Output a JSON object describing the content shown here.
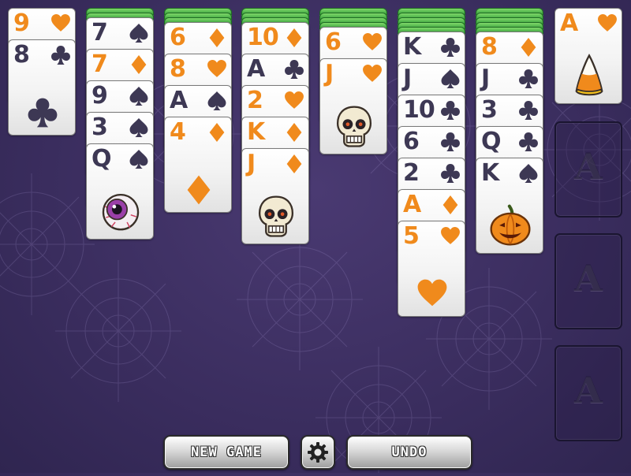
{
  "colors": {
    "background": "#3a2d5e",
    "card_back": "#2e9a36",
    "red_suit": "#f08a1c",
    "black_suit": "#3d3854"
  },
  "buttons": {
    "new_game": "NEW GAME",
    "settings_icon": "gear-icon",
    "undo": "UNDO"
  },
  "stock": {
    "cards": [
      {
        "rank": "9",
        "suit": "hearts"
      },
      {
        "rank": "8",
        "suit": "clubs"
      }
    ]
  },
  "tableau": [
    {
      "face_down": 2,
      "cards": [
        {
          "rank": "7",
          "suit": "spades"
        },
        {
          "rank": "7",
          "suit": "diamonds"
        },
        {
          "rank": "9",
          "suit": "spades"
        },
        {
          "rank": "3",
          "suit": "spades"
        },
        {
          "rank": "Q",
          "suit": "spades",
          "art": "eyeball"
        }
      ]
    },
    {
      "face_down": 3,
      "cards": [
        {
          "rank": "6",
          "suit": "diamonds"
        },
        {
          "rank": "8",
          "suit": "hearts"
        },
        {
          "rank": "A",
          "suit": "spades"
        },
        {
          "rank": "4",
          "suit": "diamonds"
        }
      ]
    },
    {
      "face_down": 3,
      "cards": [
        {
          "rank": "10",
          "suit": "diamonds"
        },
        {
          "rank": "A",
          "suit": "clubs"
        },
        {
          "rank": "2",
          "suit": "hearts"
        },
        {
          "rank": "K",
          "suit": "diamonds"
        },
        {
          "rank": "J",
          "suit": "diamonds",
          "art": "skull"
        }
      ]
    },
    {
      "face_down": 4,
      "cards": [
        {
          "rank": "6",
          "suit": "hearts"
        },
        {
          "rank": "J",
          "suit": "hearts",
          "art": "skull"
        }
      ]
    },
    {
      "face_down": 5,
      "cards": [
        {
          "rank": "K",
          "suit": "clubs"
        },
        {
          "rank": "J",
          "suit": "spades"
        },
        {
          "rank": "10",
          "suit": "clubs"
        },
        {
          "rank": "6",
          "suit": "clubs"
        },
        {
          "rank": "2",
          "suit": "clubs"
        },
        {
          "rank": "A",
          "suit": "diamonds"
        },
        {
          "rank": "5",
          "suit": "hearts"
        }
      ]
    },
    {
      "face_down": 5,
      "cards": [
        {
          "rank": "8",
          "suit": "diamonds"
        },
        {
          "rank": "J",
          "suit": "clubs"
        },
        {
          "rank": "3",
          "suit": "clubs"
        },
        {
          "rank": "Q",
          "suit": "clubs"
        },
        {
          "rank": "K",
          "suit": "spades",
          "art": "pumpkin"
        }
      ]
    }
  ],
  "foundations": [
    {
      "card": {
        "rank": "A",
        "suit": "hearts",
        "art": "candy-corn"
      }
    },
    {
      "placeholder": "A"
    },
    {
      "placeholder": "A"
    },
    {
      "placeholder": "A"
    }
  ]
}
